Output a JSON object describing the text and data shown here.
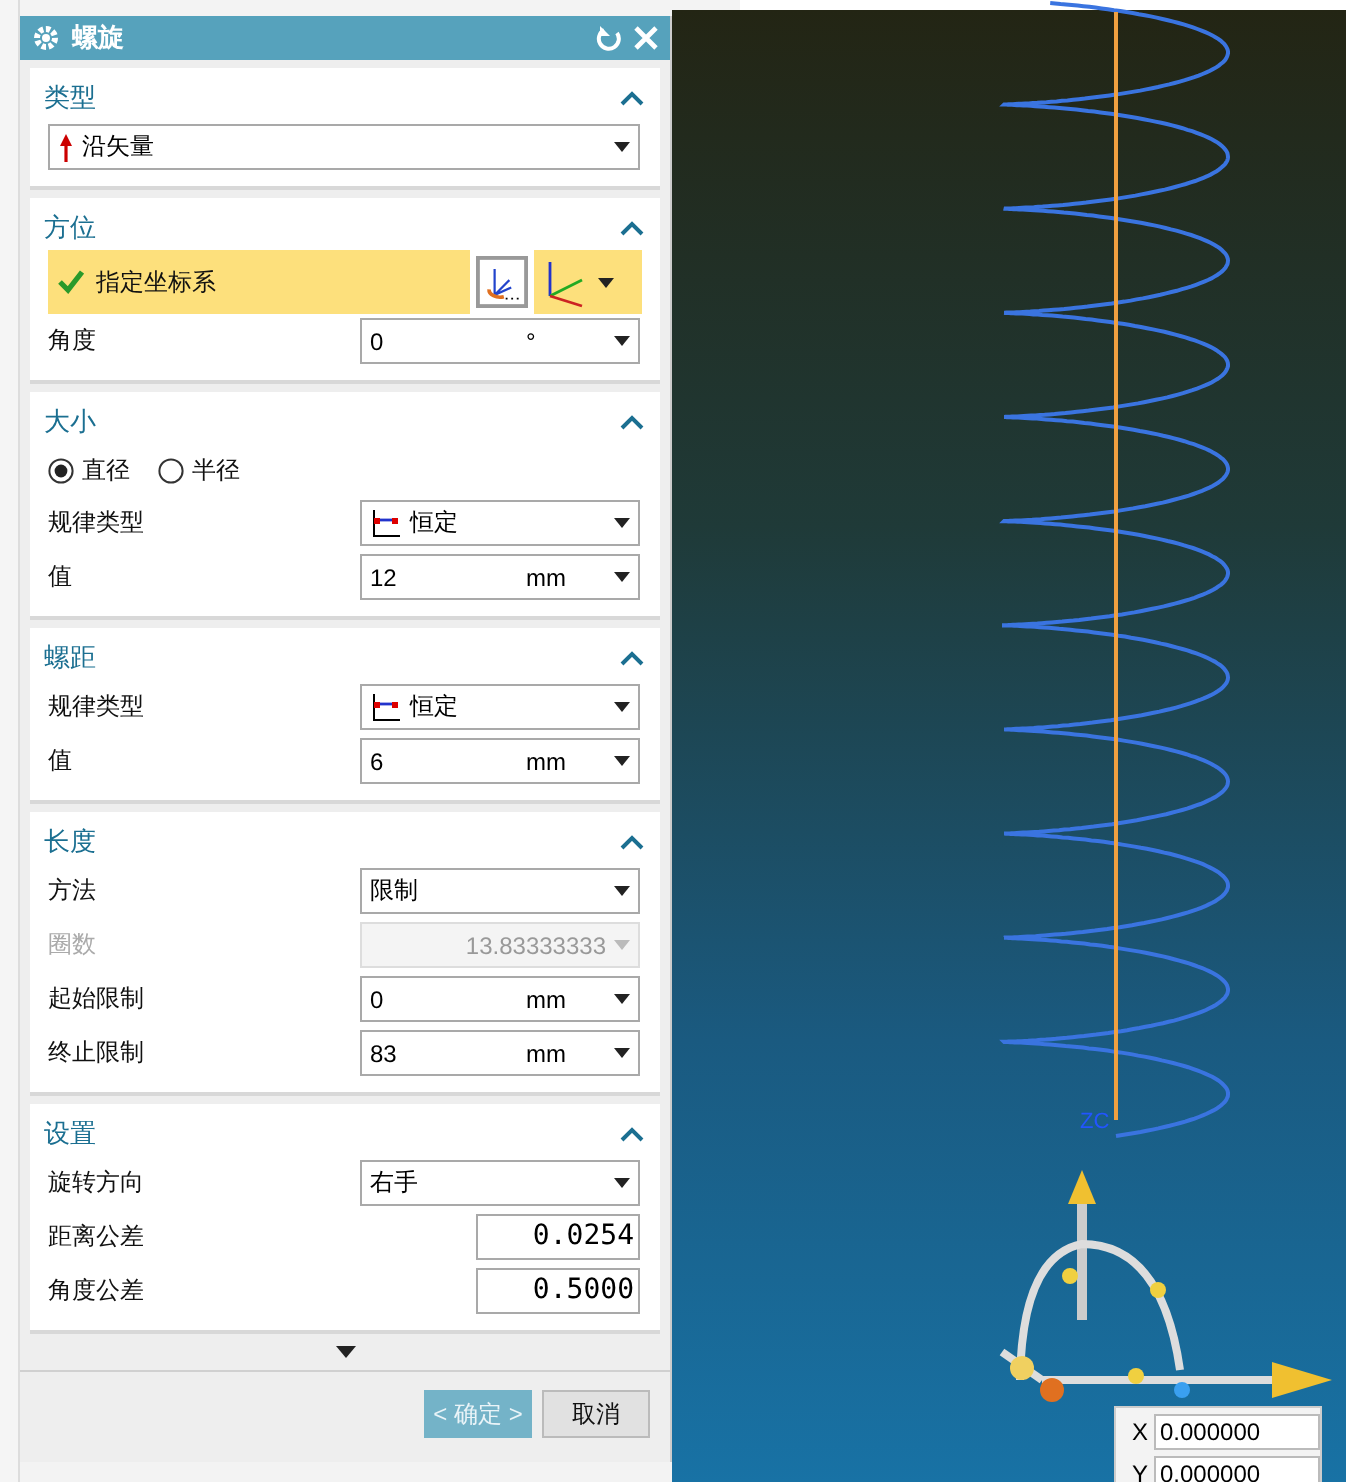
{
  "window": {
    "title": "螺旋"
  },
  "sections": [
    {
      "title": "类型",
      "expanded": true,
      "rows": [
        {
          "kind": "vector-select",
          "value": "沿矢量"
        }
      ]
    },
    {
      "title": "方位",
      "expanded": true,
      "rows": [
        {
          "kind": "csys",
          "label": "指定坐标系",
          "done": true
        },
        {
          "kind": "select",
          "label": "角度",
          "value": "0",
          "unit": "°",
          "disabled": false
        }
      ]
    },
    {
      "title": "大小",
      "expanded": true,
      "rows": [
        {
          "kind": "radio",
          "options": [
            {
              "label": "直径",
              "selected": true
            },
            {
              "label": "半径",
              "selected": false
            }
          ]
        },
        {
          "kind": "law-select",
          "label": "规律类型",
          "value": "恒定"
        },
        {
          "kind": "select",
          "label": "值",
          "value": "12",
          "unit": "mm",
          "disabled": false
        }
      ]
    },
    {
      "title": "螺距",
      "expanded": true,
      "rows": [
        {
          "kind": "law-select",
          "label": "规律类型",
          "value": "恒定"
        },
        {
          "kind": "select",
          "label": "值",
          "value": "6",
          "unit": "mm",
          "disabled": false
        }
      ]
    },
    {
      "title": "长度",
      "expanded": true,
      "rows": [
        {
          "kind": "select",
          "label": "方法",
          "value": "限制",
          "disabled": false
        },
        {
          "kind": "select",
          "label": "圈数",
          "value": "13.83333333",
          "disabled": true
        },
        {
          "kind": "select",
          "label": "起始限制",
          "value": "0",
          "unit": "mm",
          "disabled": false
        },
        {
          "kind": "select",
          "label": "终止限制",
          "value": "83",
          "unit": "mm",
          "disabled": false
        }
      ]
    },
    {
      "title": "设置",
      "expanded": true,
      "rows": [
        {
          "kind": "select",
          "label": "旋转方向",
          "value": "右手",
          "disabled": false
        },
        {
          "kind": "number",
          "label": "距离公差",
          "value": "0.0254"
        },
        {
          "kind": "number",
          "label": "角度公差",
          "value": "0.5000"
        }
      ]
    }
  ],
  "buttons": [
    {
      "label": "< 确定 >",
      "primary": true
    },
    {
      "label": "取消",
      "primary": false
    }
  ],
  "viewport": {
    "axis_label": "ZC",
    "coordinates": [
      {
        "axis": "X",
        "value": "0.000000"
      },
      {
        "axis": "Y",
        "value": "0.000000"
      }
    ]
  }
}
